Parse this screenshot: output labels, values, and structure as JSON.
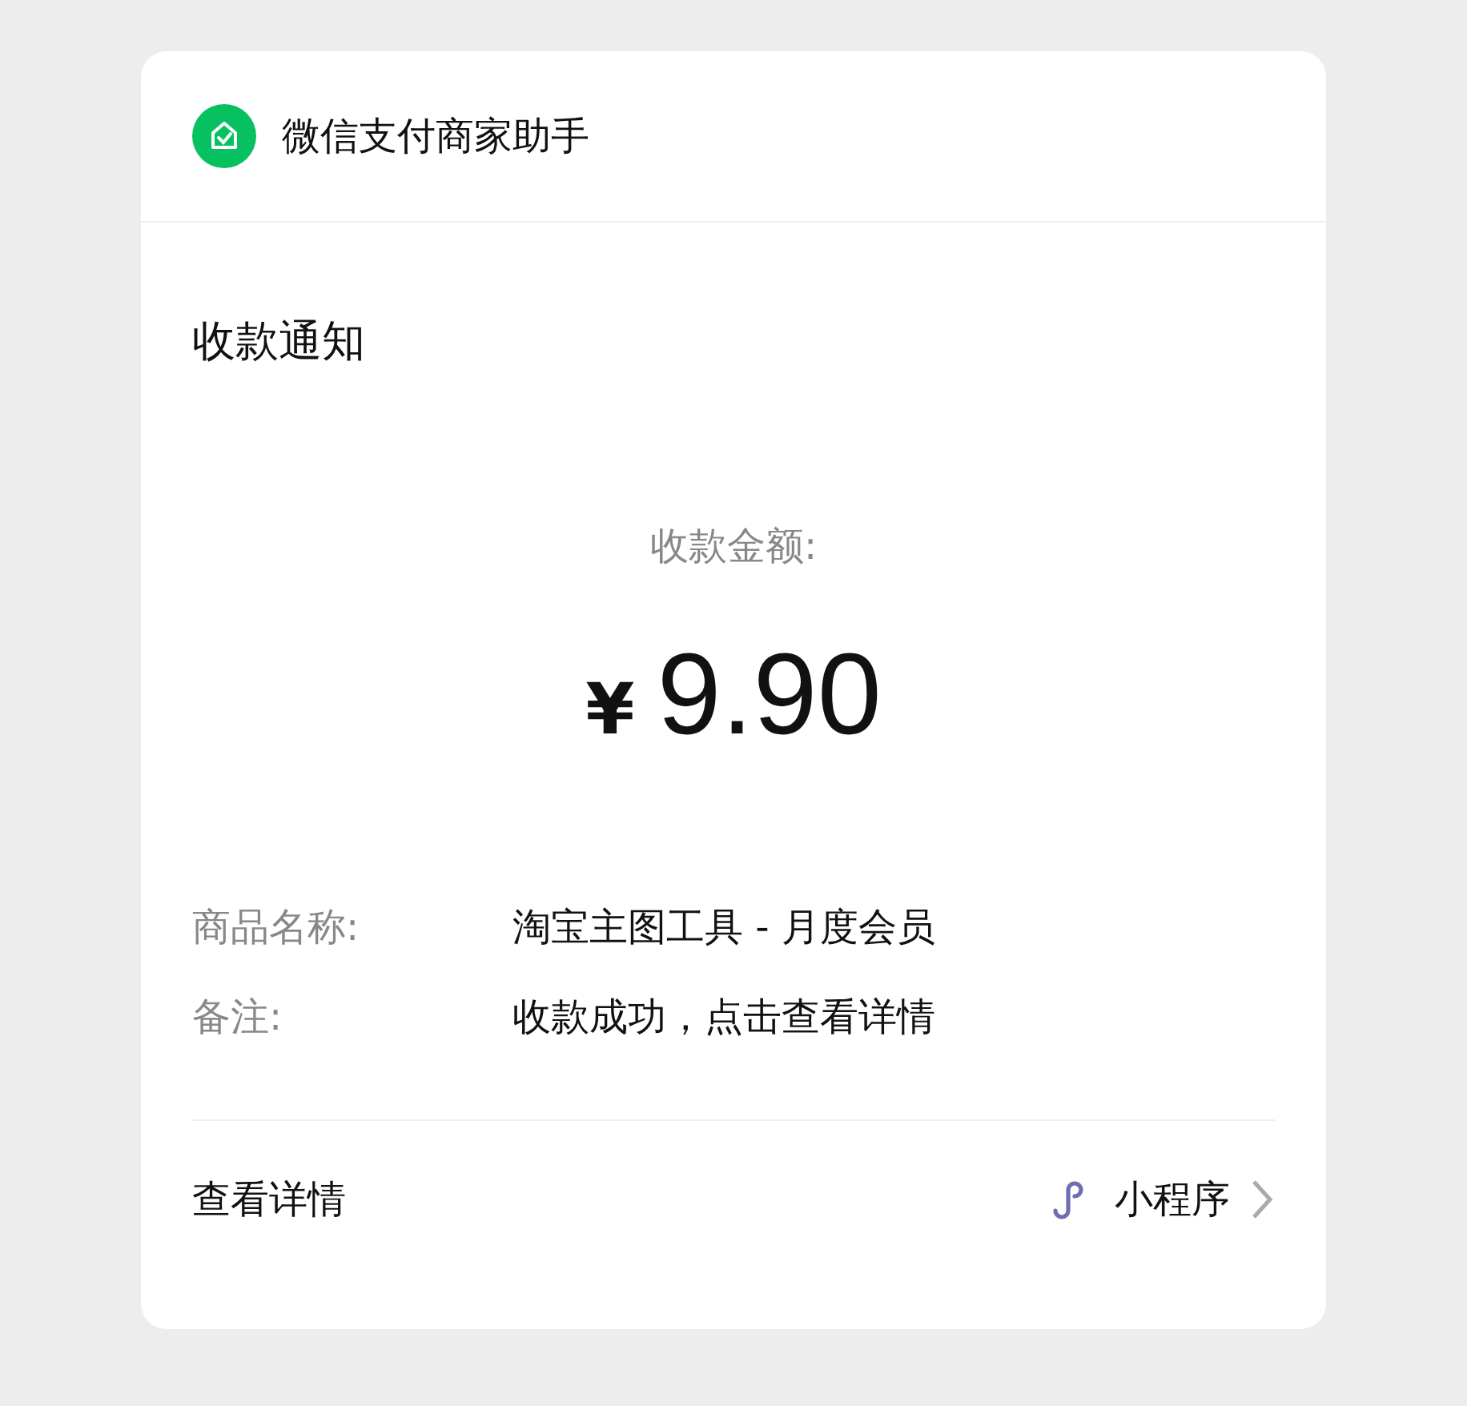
{
  "header": {
    "app_name": "微信支付商家助手"
  },
  "title": "收款通知",
  "amount": {
    "label": "收款金额:",
    "currency": "¥",
    "value": "9.90"
  },
  "fields": [
    {
      "label": "商品名称:",
      "value": "淘宝主图工具 - 月度会员"
    },
    {
      "label": "备注:",
      "value": "收款成功，点击查看详情"
    }
  ],
  "footer": {
    "link": "查看详情",
    "source": "小程序"
  }
}
